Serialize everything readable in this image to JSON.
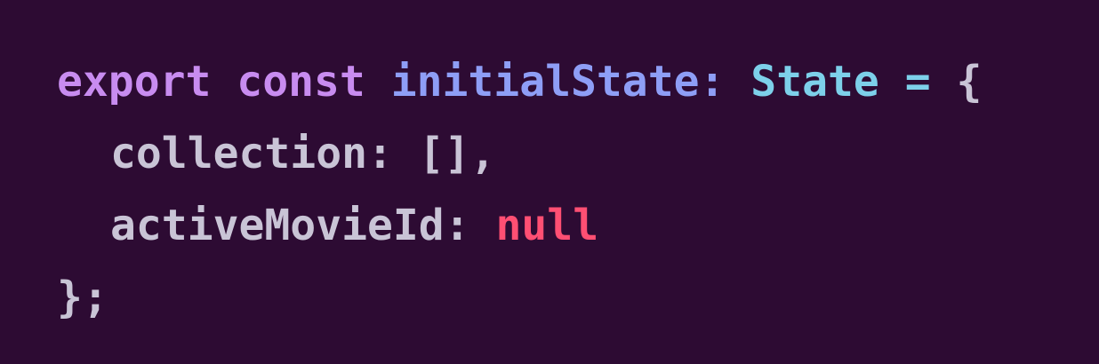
{
  "code": {
    "line1": {
      "export_kw": "export",
      "const_kw": "const",
      "identifier": "initialState",
      "colon": ":",
      "type_name": "State",
      "equals": "=",
      "open_brace": "{"
    },
    "line2": {
      "property": "collection",
      "colon": ":",
      "value": "[]",
      "comma": ","
    },
    "line3": {
      "property": "activeMovieId",
      "colon": ":",
      "value": "null"
    },
    "line4": {
      "close": "};"
    }
  },
  "colors": {
    "background": "#2d0b33",
    "keyword": "#c88cf0",
    "identifier": "#8e9ef6",
    "type": "#7dd0ea",
    "text": "#c9c4d6",
    "null": "#ff4f73"
  }
}
